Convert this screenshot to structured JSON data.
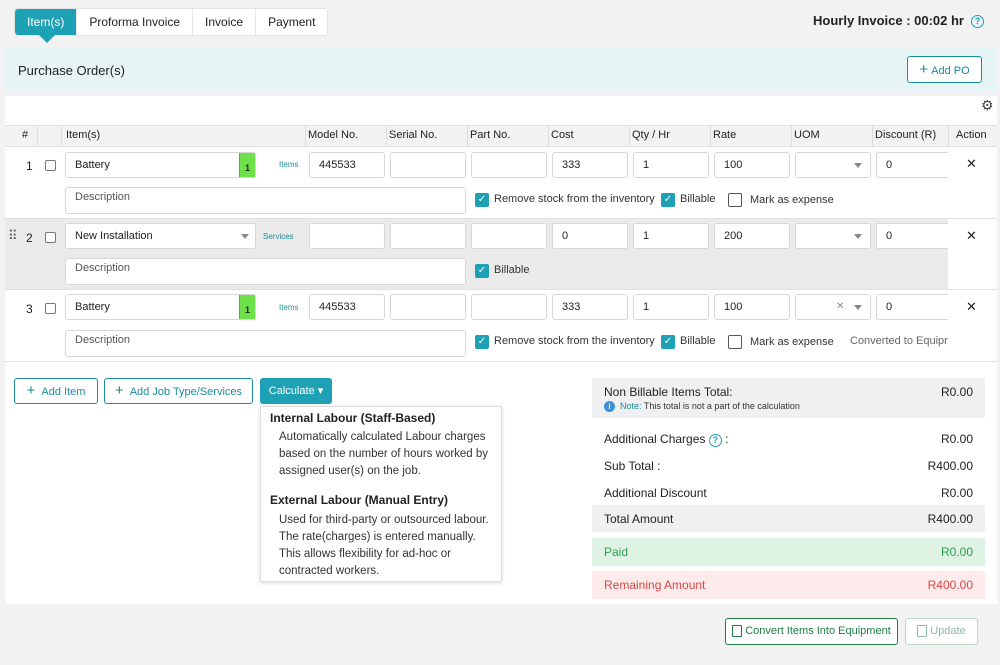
{
  "tabs": [
    "Item(s)",
    "Proforma Invoice",
    "Invoice",
    "Payment"
  ],
  "hourly": {
    "label": "Hourly Invoice : 00:02 hr",
    "help_glyph": "?"
  },
  "po": {
    "title": "Purchase Order(s)",
    "add_label": "Add PO",
    "add_glyph": "+"
  },
  "table": {
    "headers": [
      "#",
      "Item(s)",
      "Model No.",
      "Serial No.",
      "Part No.",
      "Cost",
      "Qty / Hr",
      "Rate",
      "UOM",
      "Discount (R)",
      "Action"
    ],
    "rows": [
      {
        "num": "1",
        "item": "Battery",
        "stock_badge": "1",
        "tag": "Items",
        "model": "445533",
        "serial": "",
        "part": "",
        "cost": "333",
        "qty": "1",
        "rate": "100",
        "uom": "",
        "discount": "0",
        "description_placeholder": "Description",
        "remove_stock_label": "Remove stock from the inventory",
        "billable_label": "Billable",
        "expense_label": "Mark as expense",
        "note": ""
      },
      {
        "num": "2",
        "item": "New Installation",
        "tag": "Services",
        "model": "",
        "serial": "",
        "part": "",
        "cost": "0",
        "qty": "1",
        "rate": "200",
        "uom": "",
        "discount": "0",
        "description_placeholder": "Description",
        "billable_label": "Billable"
      },
      {
        "num": "3",
        "item": "Battery",
        "stock_badge": "1",
        "tag": "Items",
        "model": "445533",
        "serial": "",
        "part": "",
        "cost": "333",
        "qty": "1",
        "rate": "100",
        "uom": "",
        "discount": "0",
        "description_placeholder": "Description",
        "remove_stock_label": "Remove stock from the inventory",
        "billable_label": "Billable",
        "expense_label": "Mark as expense",
        "note": "Converted to Equipr"
      }
    ],
    "remove_glyph": "✕",
    "clear_glyph": "✕",
    "check_glyph": "✓"
  },
  "actions": {
    "add_item": "Add Item",
    "add_job": "Add Job Type/Services",
    "calculate": "Calculate ▾",
    "plus_glyph": "+"
  },
  "calc_menu": {
    "internal_title": "Internal Labour (Staff-Based)",
    "internal_desc": "Automatically calculated Labour charges based on the number of hours worked by assigned user(s) on the job.",
    "external_title": "External Labour (Manual Entry)",
    "external_desc": "Used for third-party or outsourced labour. The rate(charges) is entered manually. This allows flexibility for ad-hoc or contracted workers."
  },
  "summary": {
    "non_billable_label": "Non Billable Items Total:",
    "non_billable_value": "R0.00",
    "note_prefix": "Note:",
    "note_text": " This total is not a part of the calculation",
    "additional_charges_label": "Additional Charges",
    "additional_charges_suffix": ":",
    "additional_charges_value": "R0.00",
    "sub_total_label": "Sub Total :",
    "sub_total_value": "R400.00",
    "additional_discount_label": "Additional Discount",
    "additional_discount_value": "R0.00",
    "total_label": "Total Amount",
    "total_value": "R400.00",
    "paid_label": "Paid",
    "paid_value": "R0.00",
    "remaining_label": "Remaining Amount",
    "remaining_value": "R400.00",
    "info_glyph": "i"
  },
  "footer": {
    "convert_label": "Convert Items Into Equipment",
    "update_label": "Update"
  },
  "colors": {
    "accent": "#1fa1b5",
    "paid_bg": "#dff3e4",
    "paid_text": "#2f9e4f",
    "remaining_bg": "#fdeaea",
    "remaining_text": "#d94848"
  }
}
